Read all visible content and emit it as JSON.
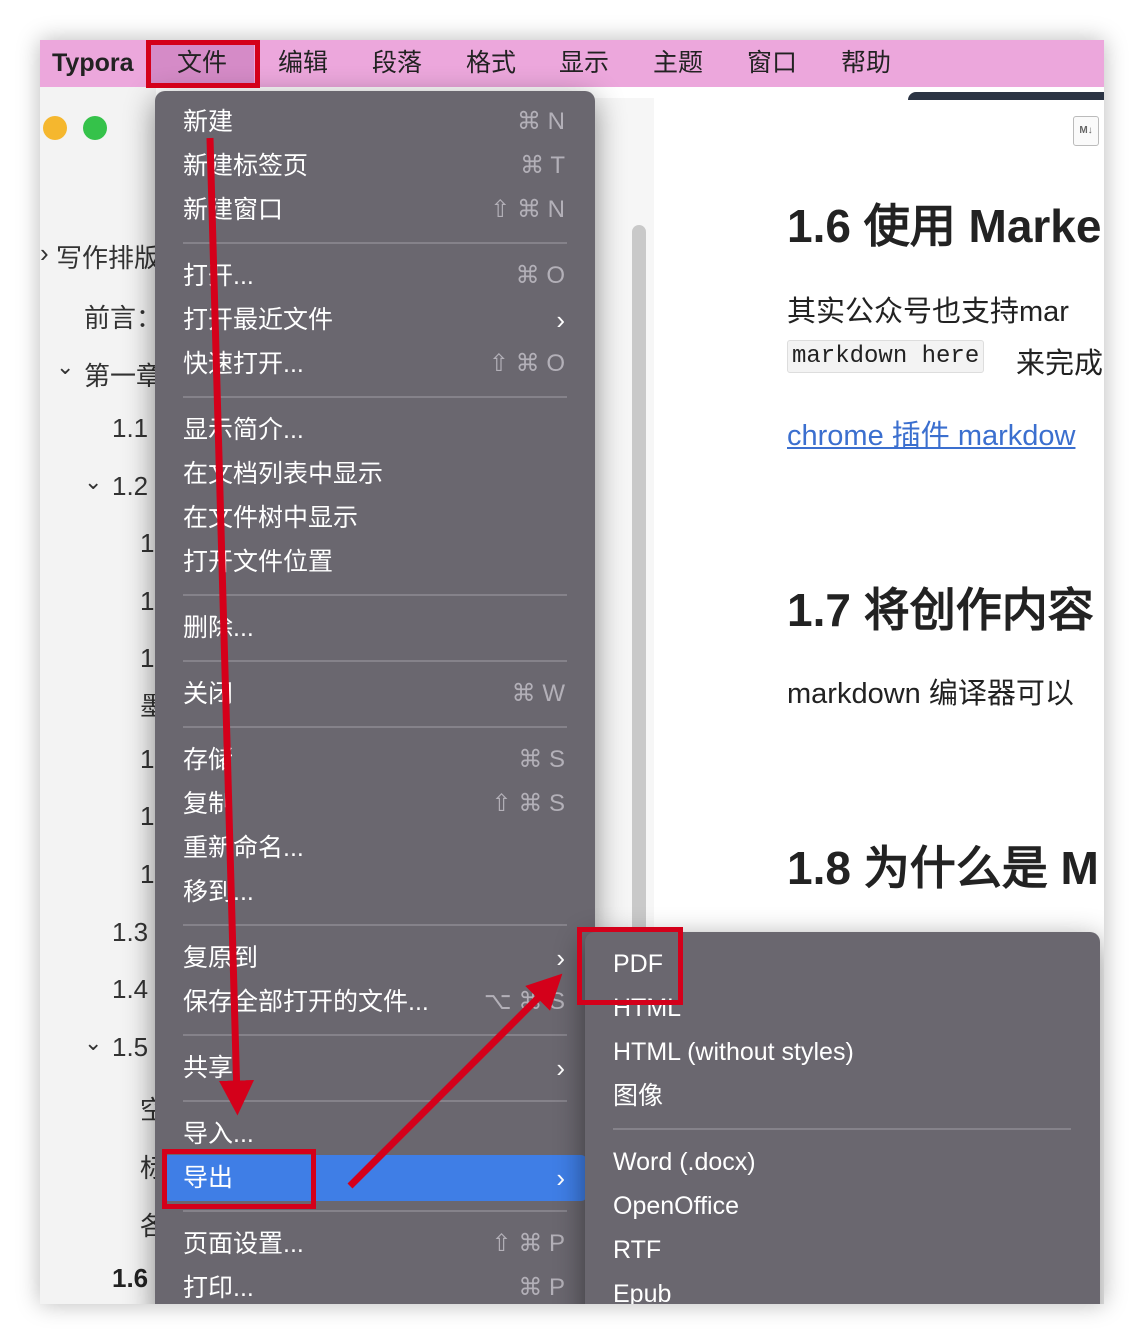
{
  "menubar": {
    "app_name": "Typora",
    "items": [
      "文件",
      "编辑",
      "段落",
      "格式",
      "显示",
      "主题",
      "窗口",
      "帮助"
    ]
  },
  "sidebar": {
    "items": [
      {
        "label": "写作排版"
      },
      {
        "label": "前言："
      },
      {
        "label": "第一章"
      },
      {
        "label": "1.1"
      },
      {
        "label": "1.2"
      },
      {
        "label": "1"
      },
      {
        "label": "1"
      },
      {
        "label": "1"
      },
      {
        "label": "墨"
      },
      {
        "label": "1"
      },
      {
        "label": "1"
      },
      {
        "label": "1"
      },
      {
        "label": "1.3"
      },
      {
        "label": "1.4"
      },
      {
        "label": "1.5"
      },
      {
        "label": "空"
      },
      {
        "label": "标"
      },
      {
        "label": "各"
      },
      {
        "label": "1.6"
      }
    ]
  },
  "file_menu": {
    "groups": [
      [
        {
          "label": "新建",
          "shortcut": "⌘ N"
        },
        {
          "label": "新建标签页",
          "shortcut": "⌘ T"
        },
        {
          "label": "新建窗口",
          "shortcut": "⇧ ⌘ N"
        }
      ],
      [
        {
          "label": "打开...",
          "shortcut": "⌘ O"
        },
        {
          "label": "打开最近文件",
          "submenu": true
        },
        {
          "label": "快速打开...",
          "shortcut": "⇧ ⌘ O"
        }
      ],
      [
        {
          "label": "显示简介..."
        },
        {
          "label": "在文档列表中显示"
        },
        {
          "label": "在文件树中显示"
        },
        {
          "label": "打开文件位置"
        }
      ],
      [
        {
          "label": "删除..."
        }
      ],
      [
        {
          "label": "关闭",
          "shortcut": "⌘ W"
        }
      ],
      [
        {
          "label": "存储",
          "shortcut": "⌘ S"
        },
        {
          "label": "复制",
          "shortcut": "⇧ ⌘ S"
        },
        {
          "label": "重新命名..."
        },
        {
          "label": "移到..."
        }
      ],
      [
        {
          "label": "复原到",
          "submenu": true
        },
        {
          "label": "保存全部打开的文件...",
          "shortcut": "⌥ ⌘ S"
        }
      ],
      [
        {
          "label": "共享",
          "submenu": true
        }
      ],
      [
        {
          "label": "导入..."
        },
        {
          "label": "导出",
          "submenu": true,
          "highlighted": true
        }
      ],
      [
        {
          "label": "页面设置...",
          "shortcut": "⇧ ⌘ P"
        },
        {
          "label": "打印...",
          "shortcut": "⌘ P"
        }
      ]
    ]
  },
  "export_submenu": {
    "groups": [
      [
        "PDF",
        "HTML",
        "HTML (without styles)",
        "图像"
      ],
      [
        "Word (.docx)",
        "OpenOffice",
        "RTF",
        "Epub"
      ]
    ]
  },
  "document": {
    "h_1_6": "1.6 使用 Marke",
    "p_1": "其实公众号也支持mar",
    "code": "markdown here",
    "p_1_tail": "来完成",
    "link": "chrome 插件 markdow",
    "h_1_7": "1.7 将创作内容",
    "p_2": "markdown 编译器可以",
    "h_1_8": "1.8 为什么是 M"
  },
  "icons": {
    "file_badge": "M↓"
  },
  "colors": {
    "menubar": "#eca7dc",
    "menu_bg": "#6a676f",
    "highlight": "#3f7ee6",
    "annotation": "#d4001a",
    "link": "#3b6fcf"
  }
}
